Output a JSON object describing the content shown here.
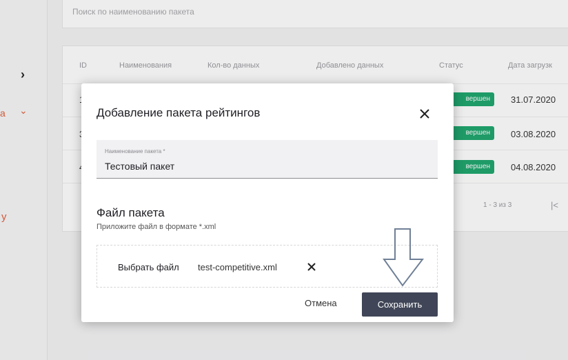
{
  "background": {
    "search_placeholder": "Поиск по наименованию пакета",
    "sidebar": {
      "chevron": "›",
      "red_text_fragment": "а",
      "red_chevron": "⌄",
      "red_text_fragment_2": "у"
    },
    "table": {
      "columns": [
        "ID",
        "Наименования",
        "Кол-во данных",
        "Добавлено данных",
        "Статус",
        "Дата загрузк"
      ],
      "rows": [
        {
          "id": "1",
          "status": "вершен",
          "date": "31.07.2020"
        },
        {
          "id": "3",
          "status": "вершен",
          "date": "03.08.2020"
        },
        {
          "id": "4",
          "status": "вершен",
          "date": "04.08.2020"
        }
      ],
      "pager_text": "1 - 3 из 3",
      "pager_first": "|<"
    }
  },
  "modal": {
    "title": "Добавление пакета рейтингов",
    "name_field": {
      "label": "Наименование пакета *",
      "value": "Тестовый пакет"
    },
    "file_section": {
      "heading": "Файл пакета",
      "hint": "Приложите файл в формате *.xml",
      "choose_label": "Выбрать файл",
      "file_name": "test-competitive.xml"
    },
    "cancel_label": "Отмена",
    "save_label": "Сохранить"
  },
  "icons": {
    "close": "close-icon",
    "remove_file": "close-icon",
    "arrow": "arrow-down-annotation"
  },
  "colors": {
    "status_green": "#1fa66e",
    "save_button": "#404657",
    "accent_red": "#e0603c"
  }
}
